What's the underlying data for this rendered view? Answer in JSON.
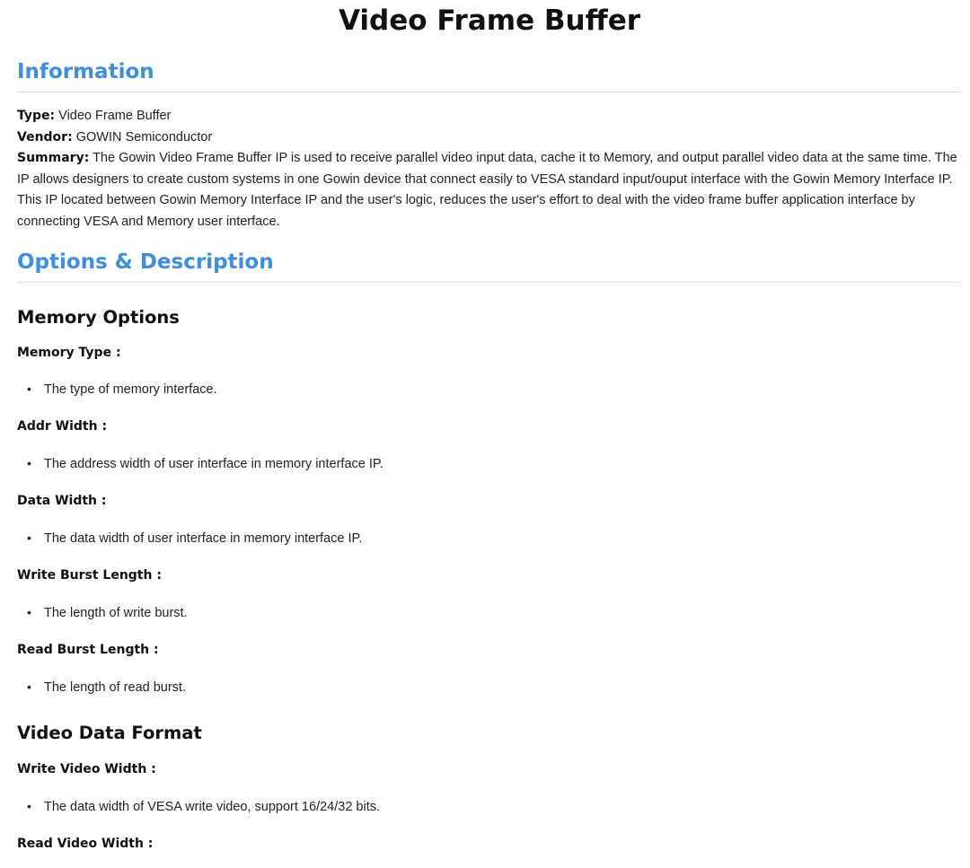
{
  "title": "Video Frame Buffer",
  "information": {
    "heading": "Information",
    "type_label": "Type:",
    "type_value": " Video Frame Buffer",
    "vendor_label": "Vendor:",
    "vendor_value": " GOWIN Semiconductor",
    "summary_label": "Summary:",
    "summary_value": " The Gowin Video Frame Buffer IP is used to receive parallel video input data, cache it to Memory, and output parallel video data at the same time. The IP allows designers to create custom systems in one Gowin device that connect easily to VESA standard input/ouput interface with the Gowin Memory Interface IP. This IP located between Gowin Memory Interface IP and the user's logic, reduces the user's effort to deal with the video frame buffer application interface by connecting VESA and Memory user interface."
  },
  "options": {
    "heading": "Options & Description",
    "memory": {
      "heading": "Memory Options",
      "items": [
        {
          "label": "Memory Type :",
          "desc": "The type of memory interface."
        },
        {
          "label": "Addr Width :",
          "desc": "The address width of user interface in memory interface IP."
        },
        {
          "label": "Data Width :",
          "desc": "The data width of user interface in memory interface IP."
        },
        {
          "label": "Write Burst Length :",
          "desc": "The length of write burst."
        },
        {
          "label": "Read Burst Length :",
          "desc": "The length of read burst."
        }
      ]
    },
    "video": {
      "heading": "Video Data Format",
      "items": [
        {
          "label": "Write Video Width :",
          "desc": "The data width of VESA write video, support 16/24/32 bits."
        },
        {
          "label": "Read Video Width :",
          "desc": ""
        }
      ]
    }
  }
}
